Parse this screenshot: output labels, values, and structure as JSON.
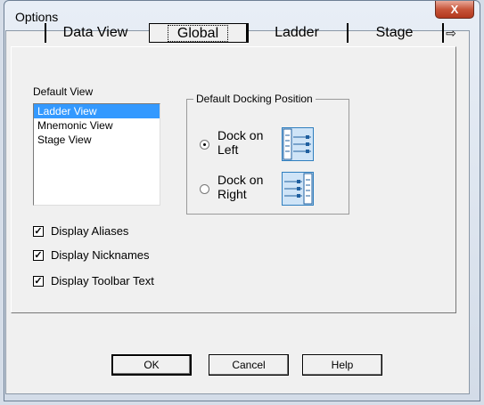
{
  "window": {
    "title": "Options",
    "close_glyph": "X"
  },
  "tabs": [
    {
      "label": "Data View"
    },
    {
      "label": "Global"
    },
    {
      "label": "Ladder"
    },
    {
      "label": "Stage"
    }
  ],
  "tab_scroll_icon": "⇨",
  "default_view": {
    "label": "Default View",
    "items": [
      "Ladder View",
      "Mnemonic View",
      "Stage View"
    ],
    "selected": "Ladder View"
  },
  "docking": {
    "title": "Default Docking Position",
    "left": {
      "line1": "Dock on",
      "line2": "Left",
      "checked": true
    },
    "right": {
      "line1": "Dock on",
      "line2": "Right",
      "checked": false
    }
  },
  "checkboxes": [
    {
      "label": "Display Aliases",
      "checked": true
    },
    {
      "label": "Display Nicknames",
      "checked": true
    },
    {
      "label": "Display Toolbar Text",
      "checked": true
    }
  ],
  "buttons": {
    "ok": "OK",
    "cancel": "Cancel",
    "help": "Help"
  },
  "colors": {
    "selection": "#3399ff",
    "dock_icon": "#2f7fbf"
  }
}
